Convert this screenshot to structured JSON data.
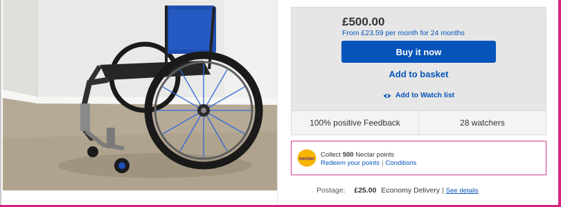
{
  "listing": {
    "image_alt": "Blue manual wheelchair",
    "price": "£500.00",
    "finance": "From £23.59 per month for 24 months",
    "buy_now_label": "Buy it now",
    "add_to_basket_label": "Add to basket",
    "watch_label": "Add to Watch list",
    "feedback": "100% positive Feedback",
    "watchers": "28 watchers"
  },
  "nectar": {
    "logo_text": "nectar",
    "collect_prefix": "Collect",
    "points": "500",
    "collect_suffix": "Nectar points",
    "redeem_link": "Redeem your points",
    "separator": "|",
    "conditions_link": "Conditions"
  },
  "postage": {
    "label": "Postage:",
    "amount": "£25.00",
    "service": "Economy Delivery",
    "separator": "|",
    "details_link": "See details"
  },
  "colors": {
    "accent": "#0654ba",
    "frame": "#d3247f",
    "nectar_logo": "#f7b500"
  }
}
